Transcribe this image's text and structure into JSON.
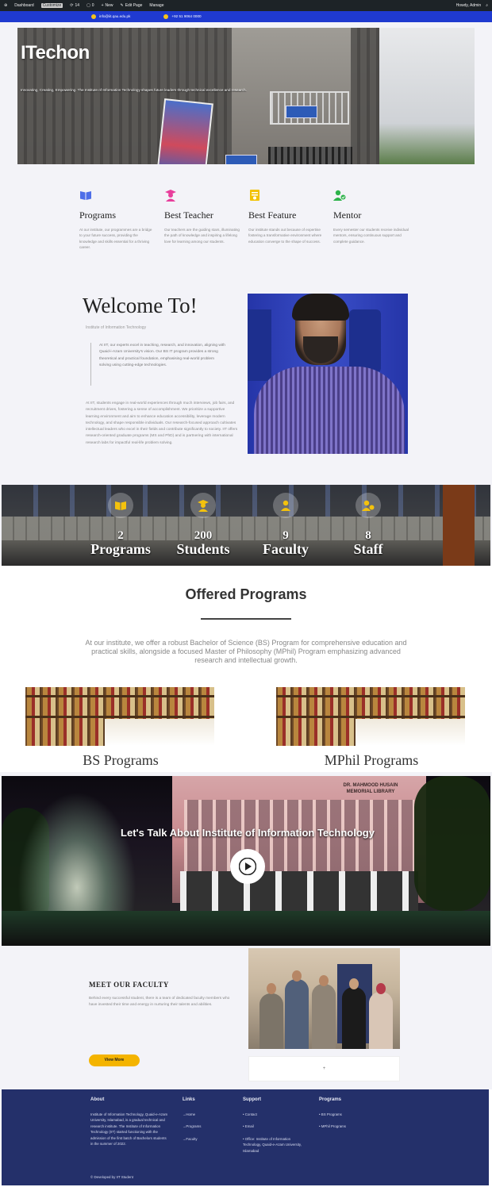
{
  "admin_bar": {
    "items": [
      "Dashboard",
      "Customize",
      "14",
      "0",
      "New",
      "Edit Page",
      "Manage"
    ],
    "right": "Howdy, Admin"
  },
  "top_strip": {
    "email": "info@iit.qau.edu.pk",
    "phone": "+92 51 9064 0000"
  },
  "hero": {
    "title": "ITechon",
    "tagline": "Innovating, Creating, Empowering. The Institute of Information Technology shapes future leaders through technical excellence and research."
  },
  "features": [
    {
      "icon": "book-icon",
      "color": "#4e6ee8",
      "title": "Programs",
      "text": "At our institute, our programmes are a bridge to your future success, providing the knowledge and skills essential for a thriving career."
    },
    {
      "icon": "teacher-icon",
      "color": "#e83e9c",
      "title": "Best Teacher",
      "text": "Our teachers are the guiding stars, illuminating the path of knowledge and inspiring a lifelong love for learning among our students."
    },
    {
      "icon": "certificate-icon",
      "color": "#f2c200",
      "title": "Best Feature",
      "text": "Our institute stands out because of expertise fostering a transformative environment where education converge to the shape of success."
    },
    {
      "icon": "mentor-icon",
      "color": "#2db34a",
      "title": "Mentor",
      "text": "Every semester our students receive individual mentors, ensuring continuous support and complete guidance."
    }
  ],
  "welcome": {
    "title": "Welcome To!",
    "subtitle": "Institute of Information Technology",
    "quote": "At IIT, our experts excel in teaching, research, and innovation, aligning with Quaid-i-Azam University's vision. Our BS IT program provides a strong theoretical and practical foundation, emphasising real-world problem solving using cutting-edge technologies.",
    "body": "At IIT, students engage in real-world experiences through much interviews, job fairs, and recruitment drives, fostering a sense of accomplishment. We prioritize a supportive learning environment and aim to enhance education accessibility, leverage modern technology, and shape responsible individuals. Our research-focused approach cultivates intellectual leaders who excel in their fields and contribute significantly to society. IIT offers research-oriented graduate programs (MS and PhD) and is partnering with international research labs for impactful real-life problem solving."
  },
  "stats": [
    {
      "icon": "book-icon",
      "value": "2",
      "label": "Programs"
    },
    {
      "icon": "student-icon",
      "value": "200",
      "label": "Students"
    },
    {
      "icon": "faculty-icon",
      "value": "9",
      "label": "Faculty"
    },
    {
      "icon": "staff-icon",
      "value": "8",
      "label": "Staff"
    }
  ],
  "offered": {
    "title": "Offered Programs",
    "description": "At our institute, we offer a robust Bachelor of Science (BS) Program for comprehensive education and practical skills, alongside a focused Master of Philosophy (MPhil) Program emphasizing advanced research and intellectual growth.",
    "programs": [
      "BS Programs",
      "MPhil Programs"
    ]
  },
  "video": {
    "title": "Let's Talk About Institute of Information Technology",
    "sign": "DR. MAHMOOD HUSAIN MEMORIAL LIBRARY"
  },
  "faculty": {
    "title": "MEET OUR FACULTY",
    "text": "Behind every successful student, there is a team of dedicated faculty members who have invested their time and energy in nurturing their talents and abilities.",
    "button": "View More",
    "caption": "+"
  },
  "footer": {
    "about_head": "About",
    "about_text": "Institute of Information Technology, Quaid-e-Azam University, Islamabad, is a gradual technical and research institute. The Institute of Information Technology (IIT) started functioning with the admission of the first batch of Bachelors students in the summer of 2022.",
    "links_head": "Links",
    "links": [
      "Home",
      "Programs",
      "Faculty"
    ],
    "support_head": "Support",
    "support": [
      "Contact",
      "Email",
      "Office: Institute of Information Technology, Quaid-e-Azam University, Islamabad"
    ],
    "programs_head": "Programs",
    "programs": [
      "BS Programs",
      "MPhil Programs"
    ],
    "copyright": "© Developed by IIT Student"
  }
}
